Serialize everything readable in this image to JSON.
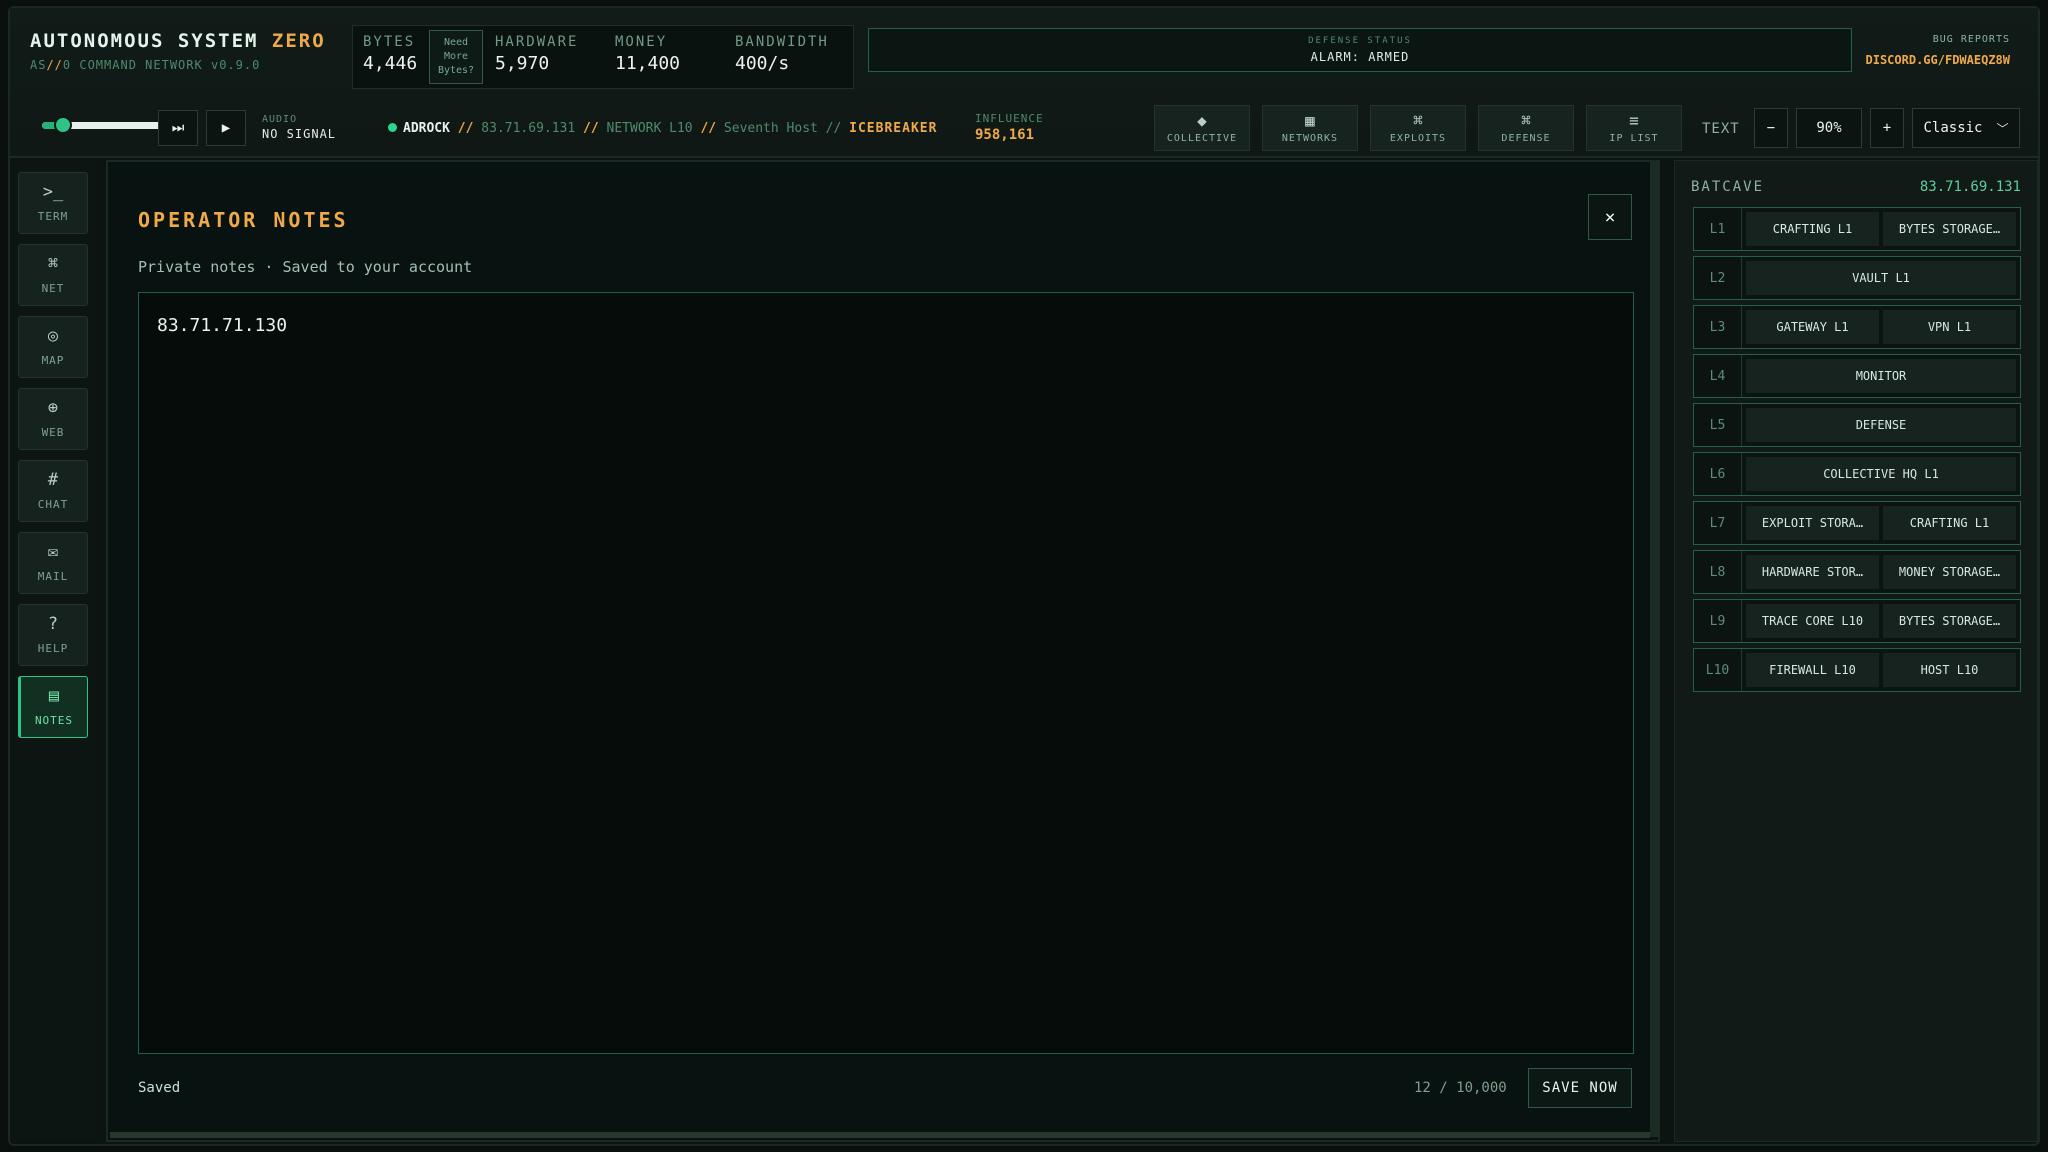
{
  "brand": {
    "title_main": "AUTONOMOUS SYSTEM ",
    "title_accent": "ZERO",
    "sub_a": "AS",
    "sub_slash": "//",
    "sub_b": "0 COMMAND NETWORK",
    "version": "v0.9.0"
  },
  "resources": {
    "bytes": {
      "label": "BYTES",
      "value": "4,446"
    },
    "need_bytes": [
      "Need",
      "More",
      "Bytes?"
    ],
    "hardware": {
      "label": "HARDWARE",
      "value": "5,970"
    },
    "money": {
      "label": "MONEY",
      "value": "11,400"
    },
    "bandwidth": {
      "label": "BANDWIDTH",
      "value": "400/s"
    }
  },
  "defense_status": {
    "label": "DEFENSE STATUS",
    "value": "ALARM: ARMED"
  },
  "bug_reports": {
    "label": "BUG REPORTS",
    "link": "DISCORD.GG/FDWAEQZ8W"
  },
  "audio": {
    "label": "AUDIO",
    "value": "NO SIGNAL",
    "volume": 0.12
  },
  "location": {
    "user": "ADROCK",
    "sep": "//",
    "ip": "83.71.69.131",
    "network": "NETWORK L10",
    "host": "Seventh Host",
    "tool": "ICEBREAKER"
  },
  "influence": {
    "label": "INFLUENCE",
    "value": "958,161"
  },
  "nav_buttons": [
    {
      "icon": "◆",
      "label": "COLLECTIVE"
    },
    {
      "icon": "▦",
      "label": "NETWORKS"
    },
    {
      "icon": "⌘",
      "label": "EXPLOITS"
    },
    {
      "icon": "⌘",
      "label": "DEFENSE"
    },
    {
      "icon": "≡",
      "label": "IP LIST"
    }
  ],
  "text_size": {
    "label": "TEXT",
    "minus": "−",
    "value": "90%",
    "plus": "+"
  },
  "theme": {
    "value": "Classic"
  },
  "sidebar": [
    {
      "icon": ">_",
      "label": "TERM"
    },
    {
      "icon": "⌘",
      "label": "NET"
    },
    {
      "icon": "◎",
      "label": "MAP"
    },
    {
      "icon": "⊕",
      "label": "WEB"
    },
    {
      "icon": "#",
      "label": "CHAT"
    },
    {
      "icon": "✉",
      "label": "MAIL"
    },
    {
      "icon": "?",
      "label": "HELP"
    },
    {
      "icon": "▤",
      "label": "NOTES"
    }
  ],
  "notes": {
    "title": "OPERATOR NOTES",
    "close": "×",
    "subtitle": "Private notes · Saved to your account",
    "content": "83.71.71.130",
    "status": "Saved",
    "count": "12 / 10,000",
    "save_label": "SAVE NOW"
  },
  "batcave": {
    "title": "BATCAVE",
    "ip": "83.71.69.131",
    "levels": [
      {
        "level": "L1",
        "items": [
          "CRAFTING L1",
          "BYTES STORAGE…"
        ]
      },
      {
        "level": "L2",
        "items": [
          "VAULT L1"
        ]
      },
      {
        "level": "L3",
        "items": [
          "GATEWAY L1",
          "VPN L1"
        ]
      },
      {
        "level": "L4",
        "items": [
          "MONITOR"
        ]
      },
      {
        "level": "L5",
        "items": [
          "DEFENSE"
        ]
      },
      {
        "level": "L6",
        "items": [
          "COLLECTIVE HQ L1"
        ]
      },
      {
        "level": "L7",
        "items": [
          "EXPLOIT STORA…",
          "CRAFTING L1"
        ]
      },
      {
        "level": "L8",
        "items": [
          "HARDWARE STOR…",
          "MONEY STORAGE…"
        ]
      },
      {
        "level": "L9",
        "items": [
          "TRACE CORE L10",
          "BYTES STORAGE…"
        ]
      },
      {
        "level": "L10",
        "items": [
          "FIREWALL L10",
          "HOST L10"
        ]
      }
    ]
  }
}
